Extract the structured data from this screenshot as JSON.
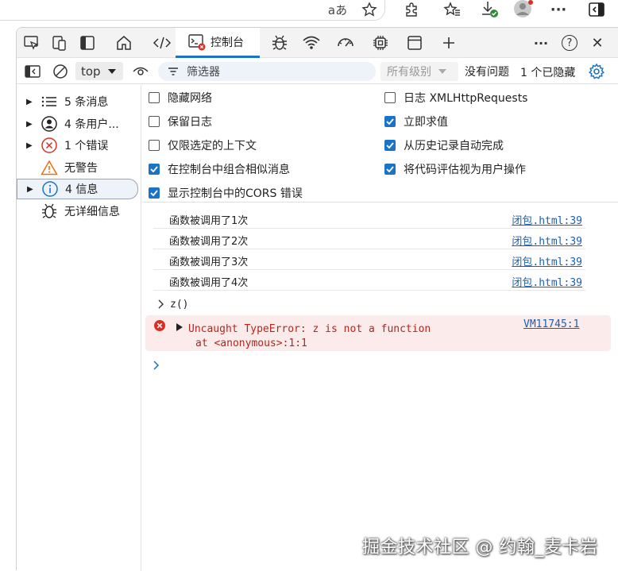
{
  "browser": {
    "toolbar_icons": [
      "read-aloud-icon",
      "favorite-star-icon",
      "extensions-icon",
      "favorites-icon",
      "downloads-icon",
      "profile-icon",
      "more-icon",
      "sidebar-toggle-icon"
    ],
    "read_aloud_label": "aあ"
  },
  "devtools": {
    "tabs": {
      "console_label": "控制台",
      "icons": [
        "inspect-icon",
        "device-emulation-icon",
        "dock-panel-icon",
        "welcome-home-icon",
        "elements-icon",
        "console-icon",
        "sources-bug-icon",
        "network-icon",
        "performance-icon",
        "memory-icon",
        "application-icon",
        "add-tab-icon",
        "more-options-icon",
        "help-icon",
        "close-icon"
      ],
      "more_label": "···",
      "help_label": "?",
      "close_label": "✕"
    },
    "toolbar": {
      "context": "top",
      "filter_placeholder": "筛选器",
      "levels": "所有级别",
      "issues": "没有问题",
      "hidden": "1 个已隐藏"
    },
    "sidebar": {
      "items": [
        {
          "label": "5 条消息",
          "icon": "list-icon"
        },
        {
          "label": "4 条用户...",
          "icon": "user-icon"
        },
        {
          "label": "1 个错误",
          "icon": "error-icon"
        },
        {
          "label": "无警告",
          "icon": "warning-icon"
        },
        {
          "label": "4 信息",
          "icon": "info-icon"
        },
        {
          "label": "无详细信息",
          "icon": "bug-icon"
        }
      ]
    },
    "settings": {
      "left": [
        {
          "label": "隐藏网络",
          "checked": false
        },
        {
          "label": "保留日志",
          "checked": false
        },
        {
          "label": "仅限选定的上下文",
          "checked": false
        },
        {
          "label": "在控制台中组合相似消息",
          "checked": true
        },
        {
          "label": "显示控制台中的CORS 错误",
          "checked": true
        }
      ],
      "right": [
        {
          "label": "日志 XMLHttpRequests",
          "checked": false
        },
        {
          "label": "立即求值",
          "checked": true
        },
        {
          "label": "从历史记录自动完成",
          "checked": true
        },
        {
          "label": "将代码评估视为用户操作",
          "checked": true
        }
      ]
    },
    "console": {
      "messages": [
        {
          "text": "函数被调用了1次",
          "source": "闭包.html:39"
        },
        {
          "text": "函数被调用了2次",
          "source": "闭包.html:39"
        },
        {
          "text": "函数被调用了3次",
          "source": "闭包.html:39"
        },
        {
          "text": "函数被调用了4次",
          "source": "闭包.html:39"
        }
      ],
      "input_echo": "z()",
      "error": {
        "message": "Uncaught TypeError: z is not a function",
        "stack": "at <anonymous>:1:1",
        "source": "VM11745:1"
      },
      "prompt": "›"
    }
  },
  "watermark": "掘金技术社区 @ 约翰_麦卡岩",
  "colors": {
    "accent": "#1a73c7",
    "error": "#d93025",
    "error_bg": "#fcebeb",
    "warning": "#e8710a",
    "info": "#1a73c7"
  }
}
